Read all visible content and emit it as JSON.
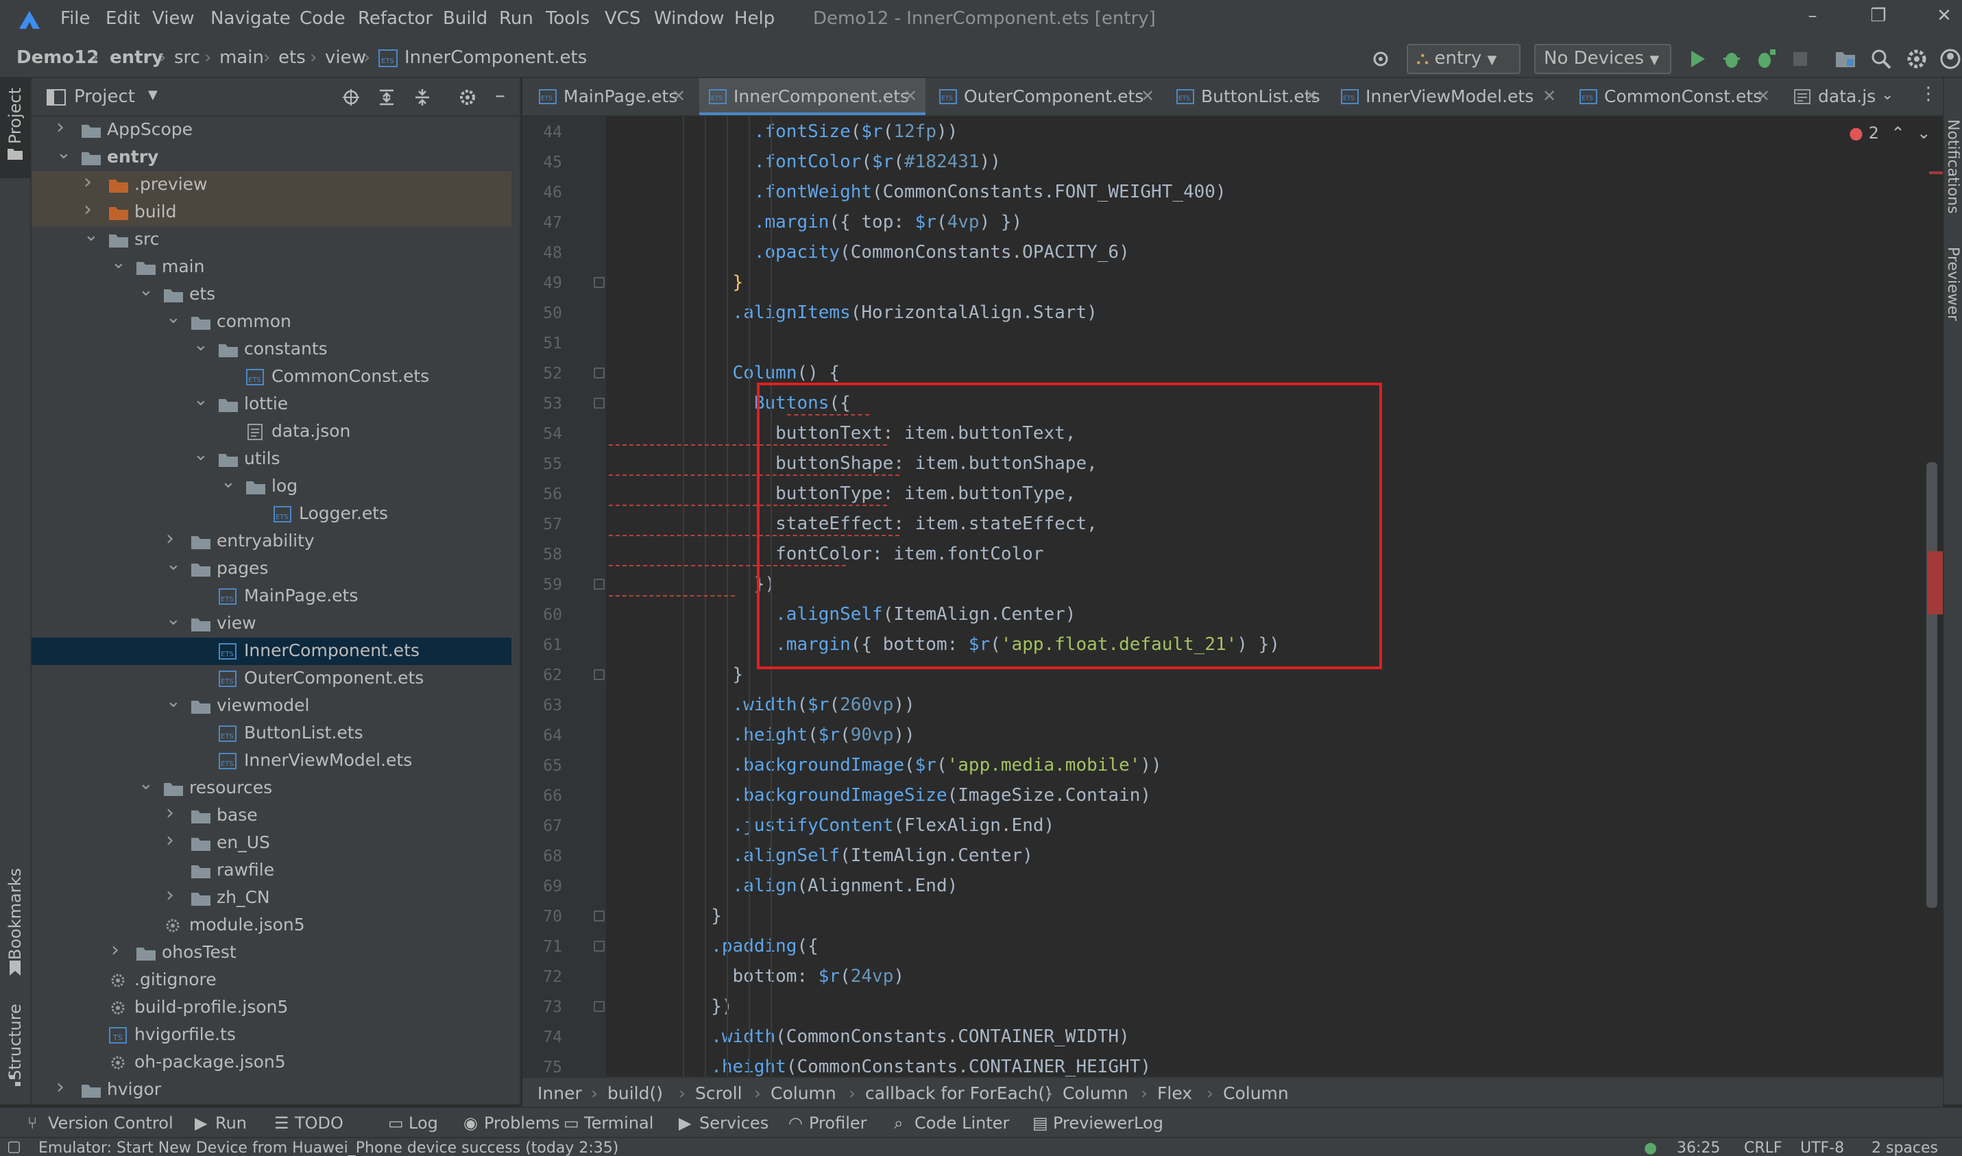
{
  "menubar": {
    "items": [
      "File",
      "Edit",
      "View",
      "Navigate",
      "Code",
      "Refactor",
      "Build",
      "Run",
      "Tools",
      "VCS",
      "Window",
      "Help"
    ],
    "window_title": "Demo12 - InnerComponent.ets [entry]"
  },
  "navbar": {
    "breadcrumb": [
      "Demo12",
      "entry",
      "src",
      "main",
      "ets",
      "view",
      "InnerComponent.ets"
    ],
    "module_select": "entry",
    "device_select": "No Devices"
  },
  "left_strip": {
    "project": "Project",
    "bookmarks": "Bookmarks",
    "structure": "Structure"
  },
  "right_strip": {
    "notifications": "Notifications",
    "previewer": "Previewer"
  },
  "project_panel": {
    "title": "Project",
    "tree": [
      {
        "label": "AppScope",
        "depth": 0,
        "type": "folder",
        "expanded": false
      },
      {
        "label": "entry",
        "depth": 0,
        "type": "folder",
        "expanded": true,
        "bold": true
      },
      {
        "label": ".preview",
        "depth": 1,
        "type": "folder-orange",
        "expanded": false,
        "highlight": true
      },
      {
        "label": "build",
        "depth": 1,
        "type": "folder-orange",
        "expanded": false,
        "highlight": true
      },
      {
        "label": "src",
        "depth": 1,
        "type": "folder",
        "expanded": true
      },
      {
        "label": "main",
        "depth": 2,
        "type": "folder",
        "expanded": true
      },
      {
        "label": "ets",
        "depth": 3,
        "type": "folder",
        "expanded": true
      },
      {
        "label": "common",
        "depth": 4,
        "type": "folder",
        "expanded": true
      },
      {
        "label": "constants",
        "depth": 5,
        "type": "folder",
        "expanded": true
      },
      {
        "label": "CommonConst.ets",
        "depth": 6,
        "type": "ets"
      },
      {
        "label": "lottie",
        "depth": 5,
        "type": "folder",
        "expanded": true
      },
      {
        "label": "data.json",
        "depth": 6,
        "type": "json"
      },
      {
        "label": "utils",
        "depth": 5,
        "type": "folder",
        "expanded": true
      },
      {
        "label": "log",
        "depth": 6,
        "type": "folder",
        "expanded": true
      },
      {
        "label": "Logger.ets",
        "depth": 7,
        "type": "ets"
      },
      {
        "label": "entryability",
        "depth": 4,
        "type": "folder",
        "expanded": false
      },
      {
        "label": "pages",
        "depth": 4,
        "type": "folder",
        "expanded": true
      },
      {
        "label": "MainPage.ets",
        "depth": 5,
        "type": "ets"
      },
      {
        "label": "view",
        "depth": 4,
        "type": "folder",
        "expanded": true
      },
      {
        "label": "InnerComponent.ets",
        "depth": 5,
        "type": "ets",
        "selected": true
      },
      {
        "label": "OuterComponent.ets",
        "depth": 5,
        "type": "ets"
      },
      {
        "label": "viewmodel",
        "depth": 4,
        "type": "folder",
        "expanded": true
      },
      {
        "label": "ButtonList.ets",
        "depth": 5,
        "type": "ets"
      },
      {
        "label": "InnerViewModel.ets",
        "depth": 5,
        "type": "ets"
      },
      {
        "label": "resources",
        "depth": 3,
        "type": "folder",
        "expanded": true
      },
      {
        "label": "base",
        "depth": 4,
        "type": "folder",
        "expanded": false
      },
      {
        "label": "en_US",
        "depth": 4,
        "type": "folder",
        "expanded": false
      },
      {
        "label": "rawfile",
        "depth": 4,
        "type": "folder",
        "leaf": true
      },
      {
        "label": "zh_CN",
        "depth": 4,
        "type": "folder",
        "expanded": false
      },
      {
        "label": "module.json5",
        "depth": 3,
        "type": "config"
      },
      {
        "label": "ohosTest",
        "depth": 2,
        "type": "folder",
        "expanded": false
      },
      {
        "label": ".gitignore",
        "depth": 1,
        "type": "config"
      },
      {
        "label": "build-profile.json5",
        "depth": 1,
        "type": "config"
      },
      {
        "label": "hvigorfile.ts",
        "depth": 1,
        "type": "ts"
      },
      {
        "label": "oh-package.json5",
        "depth": 1,
        "type": "config"
      },
      {
        "label": "hvigor",
        "depth": 0,
        "type": "folder",
        "expanded": false
      }
    ]
  },
  "editor_tabs": [
    {
      "label": "MainPage.ets",
      "active": false
    },
    {
      "label": "InnerComponent.ets",
      "active": true
    },
    {
      "label": "OuterComponent.ets",
      "active": false
    },
    {
      "label": "ButtonList.ets",
      "active": false
    },
    {
      "label": "InnerViewModel.ets",
      "active": false
    },
    {
      "label": "CommonConst.ets",
      "active": false
    },
    {
      "label": "data.js",
      "active": false
    }
  ],
  "editor": {
    "error_count": "2",
    "lines": [
      {
        "n": "44",
        "html": "            <span class=\"fn\">.fontSize</span>(<span class=\"fn\">$r</span>(<span class=\"num\">12fp</span>))"
      },
      {
        "n": "45",
        "html": "            <span class=\"fn\">.fontColor</span>(<span class=\"fn\">$r</span>(<span class=\"num\">#182431</span>))"
      },
      {
        "n": "46",
        "html": "            <span class=\"fn\">.fontWeight</span>(CommonConstants.FONT_WEIGHT_400)"
      },
      {
        "n": "47",
        "html": "            <span class=\"fn\">.margin</span>({ top: <span class=\"fn\">$r</span>(<span class=\"num\">4vp</span>) })"
      },
      {
        "n": "48",
        "html": "            <span class=\"fn\">.opacity</span>(CommonConstants.OPACITY_6)"
      },
      {
        "n": "49",
        "html": "          <span class=\"br\">}</span>"
      },
      {
        "n": "50",
        "html": "          <span class=\"fn\">.alignItems</span>(HorizontalAlign.Start)"
      },
      {
        "n": "51",
        "html": ""
      },
      {
        "n": "52",
        "html": "          <span class=\"fn\">Column</span>() {"
      },
      {
        "n": "53",
        "html": "            <span class=\"fn\">Buttons</span>({"
      },
      {
        "n": "54",
        "html": "              buttonText: item.buttonText,"
      },
      {
        "n": "55",
        "html": "              buttonShape: item.buttonShape,"
      },
      {
        "n": "56",
        "html": "              buttonType: item.buttonType,"
      },
      {
        "n": "57",
        "html": "              stateEffect: item.stateEffect,"
      },
      {
        "n": "58",
        "html": "              fontColor: item.fontColor"
      },
      {
        "n": "59",
        "html": "            })"
      },
      {
        "n": "60",
        "html": "              <span class=\"fn\">.alignSelf</span>(ItemAlign.Center)"
      },
      {
        "n": "61",
        "html": "              <span class=\"fn\">.margin</span>({ bottom: <span class=\"fn\">$r</span>(<span class=\"str\">'app.float.default_21'</span>) })"
      },
      {
        "n": "62",
        "html": "          }"
      },
      {
        "n": "63",
        "html": "          <span class=\"fn\">.width</span>(<span class=\"fn\">$r</span>(<span class=\"num\">260vp</span>))"
      },
      {
        "n": "64",
        "html": "          <span class=\"fn\">.height</span>(<span class=\"fn\">$r</span>(<span class=\"num\">90vp</span>))"
      },
      {
        "n": "65",
        "html": "          <span class=\"fn\">.backgroundImage</span>(<span class=\"fn\">$r</span>(<span class=\"str\">'app.media.mobile'</span>))"
      },
      {
        "n": "66",
        "html": "          <span class=\"fn\">.backgroundImageSize</span>(ImageSize.Contain)"
      },
      {
        "n": "67",
        "html": "          <span class=\"fn\">.justifyContent</span>(FlexAlign.End)"
      },
      {
        "n": "68",
        "html": "          <span class=\"fn\">.alignSelf</span>(ItemAlign.Center)"
      },
      {
        "n": "69",
        "html": "          <span class=\"fn\">.align</span>(Alignment.End)"
      },
      {
        "n": "70",
        "html": "        }"
      },
      {
        "n": "71",
        "html": "        <span class=\"fn\">.padding</span>({"
      },
      {
        "n": "72",
        "html": "          bottom: <span class=\"fn\">$r</span>(<span class=\"num\">24vp</span>)"
      },
      {
        "n": "73",
        "html": "        })"
      },
      {
        "n": "74",
        "html": "        <span class=\"fn\">.width</span>(CommonConstants.CONTAINER_WIDTH)"
      },
      {
        "n": "75",
        "html": "        <span class=\"fn\">.height</span>(CommonConstants.CONTAINER_HEIGHT)"
      }
    ]
  },
  "code_breadcrumb": [
    "Inner",
    "build()",
    "Scroll",
    "Column",
    "callback for ForEach()",
    "Column",
    "Flex",
    "Column"
  ],
  "tool_windows": [
    "Version Control",
    "Run",
    "TODO",
    "Log",
    "Problems",
    "Terminal",
    "Services",
    "Profiler",
    "Code Linter",
    "PreviewerLog"
  ],
  "status": {
    "message": "Emulator: Start New Device  from  Huawei_Phone device success (today 2:35)",
    "position": "36:25",
    "line_sep": "CRLF",
    "encoding": "UTF-8",
    "indent": "2 spaces"
  },
  "colors": {
    "accent": "#4a88c7",
    "error_box": "#e01f1f",
    "folder": "#87939a",
    "folder_orange": "#c0632b"
  }
}
